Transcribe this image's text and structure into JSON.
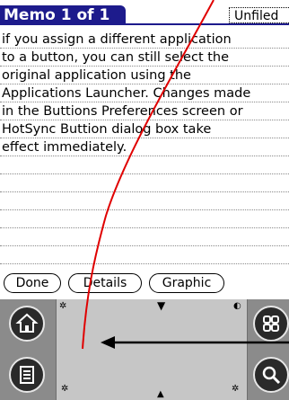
{
  "title": "Memo 1 of 1",
  "category": "Unfiled",
  "memo_lines": [
    "if you assign a different application",
    "to a button, you can still select the",
    "original application using the",
    "Applications Launcher. Changes made",
    "in the Buttions Preferences screen or",
    "HotSync Buttion dialog box take",
    "effect immediately.",
    "",
    "",
    "",
    "",
    "",
    ""
  ],
  "buttons": {
    "done": "Done",
    "details": "Details",
    "graphic": "Graphic"
  },
  "icons": {
    "home": "home-icon",
    "menu": "menu-icon",
    "apps": "apps-icon",
    "find": "find-icon"
  },
  "colors": {
    "title_bar": "#1d1b8c",
    "annotation_curve": "#e00000",
    "annotation_arrow": "#000000"
  }
}
